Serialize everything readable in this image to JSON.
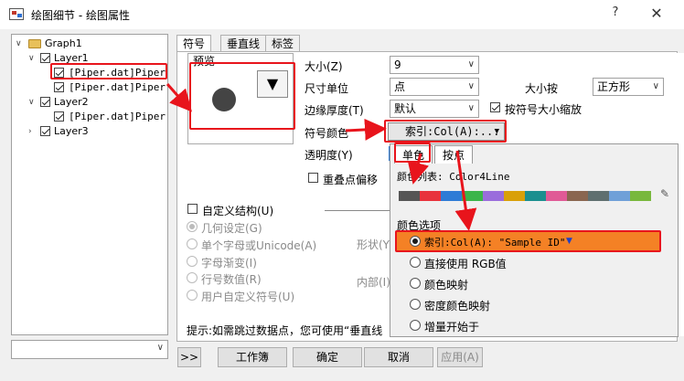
{
  "window": {
    "title": "绘图细节 - 绘图属性",
    "help_label": "?",
    "close_label": "✕"
  },
  "tree": {
    "items": [
      {
        "label": "Graph1",
        "level": 0,
        "checked": null
      },
      {
        "label": "Layer1",
        "level": 1,
        "checked": true
      },
      {
        "label": "[Piper.dat]Piper",
        "level": 2,
        "checked": true,
        "highlighted": true
      },
      {
        "label": "[Piper.dat]Piper",
        "level": 2,
        "checked": true
      },
      {
        "label": "Layer2",
        "level": 1,
        "checked": true
      },
      {
        "label": "[Piper.dat]Piper",
        "level": 2,
        "checked": true
      },
      {
        "label": "Layer3",
        "level": 1,
        "checked": true
      }
    ]
  },
  "tabs": [
    "符号",
    "垂直线",
    "标签"
  ],
  "preview": {
    "label": "预览",
    "drop_glyph": "▼"
  },
  "symbol": {
    "size_label": "大小(Z)",
    "size_value": "9",
    "unit_label": "尺寸单位",
    "unit_value": "点",
    "scale_label": "大小按",
    "scale_value": "正方形",
    "edge_label": "边缘厚度(T)",
    "edge_value": "默认",
    "scale_check_label": "按符号大小缩放",
    "color_label": "符号颜色",
    "color_value": "索引:Col(A):...",
    "transparency_label": "透明度(Y)",
    "overlap_label": "重叠点偏移",
    "custom_struct_label": "自定义结构(U)",
    "geometry_label": "几何设定(G)",
    "single_char_label": "单个字母或Unicode(A)",
    "char_gradient_label": "字母渐变(I)",
    "row_value_label": "行号数值(R)",
    "user_symbol_label": "用户自定义符号(U)",
    "shape_label": "形状(Y)",
    "inner_label": "内部(I)",
    "hint": "提示:如需跳过数据点，您可使用“垂直线"
  },
  "popup": {
    "tab_single": "单色",
    "tab_by_point": "按点",
    "palette_label": "颜色列表: Color4Line",
    "palette_colors": [
      "#555555",
      "#e8323c",
      "#2e7bd6",
      "#3bb54a",
      "#9a6ddc",
      "#d9a008",
      "#1b8f8f",
      "#e05a96",
      "#8a6650",
      "#5f6f6f",
      "#6fa0d8",
      "#78b83c"
    ],
    "options_label": "颜色选项",
    "options": [
      {
        "label": "索引:Col(A): \"Sample ID\"",
        "selected": true
      },
      {
        "label": "直接使用 RGB值",
        "selected": false
      },
      {
        "label": "颜色映射",
        "selected": false
      },
      {
        "label": "密度颜色映射",
        "selected": false
      },
      {
        "label": "增量开始于",
        "selected": false
      }
    ],
    "highlight_color": "#f48125"
  },
  "buttons": {
    "more": ">>",
    "workbook": "工作簿",
    "ok": "确定",
    "cancel": "取消",
    "apply": "应用(A)"
  },
  "annotation_color": "#e8141c"
}
